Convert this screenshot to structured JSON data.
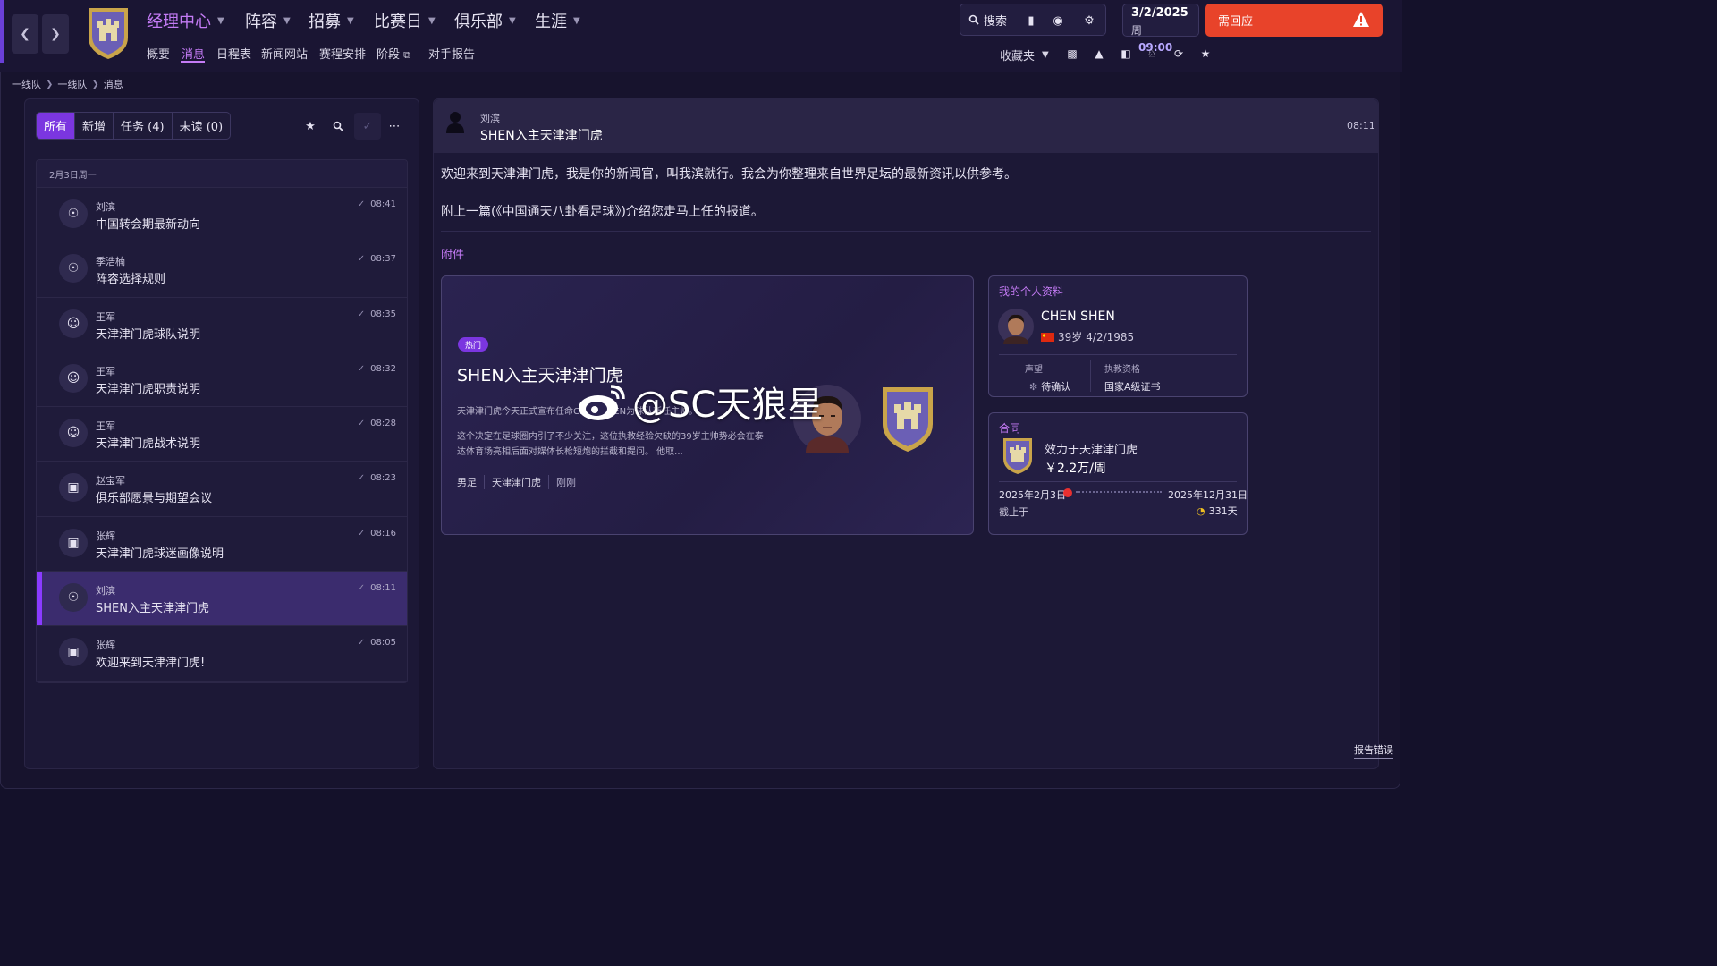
{
  "nav": {
    "back_icon": "chevron-left-icon",
    "forward_icon": "chevron-right-icon",
    "main_items": [
      {
        "label": "经理中心"
      },
      {
        "label": "阵容"
      },
      {
        "label": "招募"
      },
      {
        "label": "比赛日"
      },
      {
        "label": "俱乐部"
      },
      {
        "label": "生涯"
      }
    ],
    "sub_items": [
      {
        "label": "概要"
      },
      {
        "label": "消息"
      },
      {
        "label": "日程表"
      },
      {
        "label": "新闻网站"
      },
      {
        "label": "赛程安排"
      },
      {
        "label": "阶段"
      },
      {
        "label": "对手报告"
      }
    ]
  },
  "toolbar": {
    "search_label": "搜索",
    "date": "3/2/2025",
    "weekday": "周一",
    "time": "09:00",
    "respond_label": "需回应",
    "favorites_label": "收藏夹",
    "respond_color": "#e8432a",
    "accent_color": "#c47bf5"
  },
  "breadcrumb": [
    "一线队",
    "一线队",
    "消息"
  ],
  "filters": {
    "all": "所有",
    "new": "新增",
    "tasks": "任务 (4)",
    "unread": "未读 (0)"
  },
  "inbox": {
    "date_header": "2月3日周一",
    "messages": [
      {
        "sender": "刘滨",
        "subject": "中国转会期最新动向",
        "time": "08:41"
      },
      {
        "sender": "季浩楠",
        "subject": "阵容选择规则",
        "time": "08:37"
      },
      {
        "sender": "王军",
        "subject": "天津津门虎球队说明",
        "time": "08:35"
      },
      {
        "sender": "王军",
        "subject": "天津津门虎职责说明",
        "time": "08:32"
      },
      {
        "sender": "王军",
        "subject": "天津津门虎战术说明",
        "time": "08:28"
      },
      {
        "sender": "赵宝军",
        "subject": "俱乐部愿景与期望会议",
        "time": "08:23"
      },
      {
        "sender": "张辉",
        "subject": "天津津门虎球迷画像说明",
        "time": "08:16"
      },
      {
        "sender": "刘滨",
        "subject": "SHEN入主天津津门虎",
        "time": "08:11"
      },
      {
        "sender": "张辉",
        "subject": "欢迎来到天津津门虎!",
        "time": "08:05"
      }
    ]
  },
  "message": {
    "sender": "刘滨",
    "subject": "SHEN入主天津津门虎",
    "time": "08:11",
    "body_1": "欢迎来到天津津门虎，我是你的新闻官，叫我滨就行。我会为你整理来自世界足坛的最新资讯以供参考。",
    "body_2": "附上一篇(《中国通天八卦看足球》)介绍您走马上任的报道。",
    "attachments_label": "附件"
  },
  "news_card": {
    "badge": "热门",
    "title": "SHEN入主天津津门虎",
    "lead": "天津津门虎今天正式宣布任命CHEN SHEN为球队新任主帅。",
    "body": "这个决定在足球圈内引了不少关注，这位执教经验欠缺的39岁主帅势必会在泰达体育场亮相后面对媒体长枪短炮的拦截和提问。 他取...",
    "tags": [
      "男足",
      "天津津门虎",
      "刚刚"
    ]
  },
  "watermark": "@SC天狼星",
  "profile": {
    "label": "我的个人资料",
    "name": "CHEN SHEN",
    "age": "39岁",
    "dob": "4/2/1985",
    "reputation_label": "声望",
    "reputation_value": "待确认",
    "license_label": "执教资格",
    "license_value": "国家A级证书"
  },
  "contract": {
    "label": "合同",
    "club": "效力于天津津门虎",
    "wage": "￥2.2万/周",
    "start": "2025年2月3日",
    "end": "2025年12月31日",
    "until_label": "截止于",
    "days_left": "331天"
  },
  "footer": {
    "report_error": "报告错误"
  }
}
